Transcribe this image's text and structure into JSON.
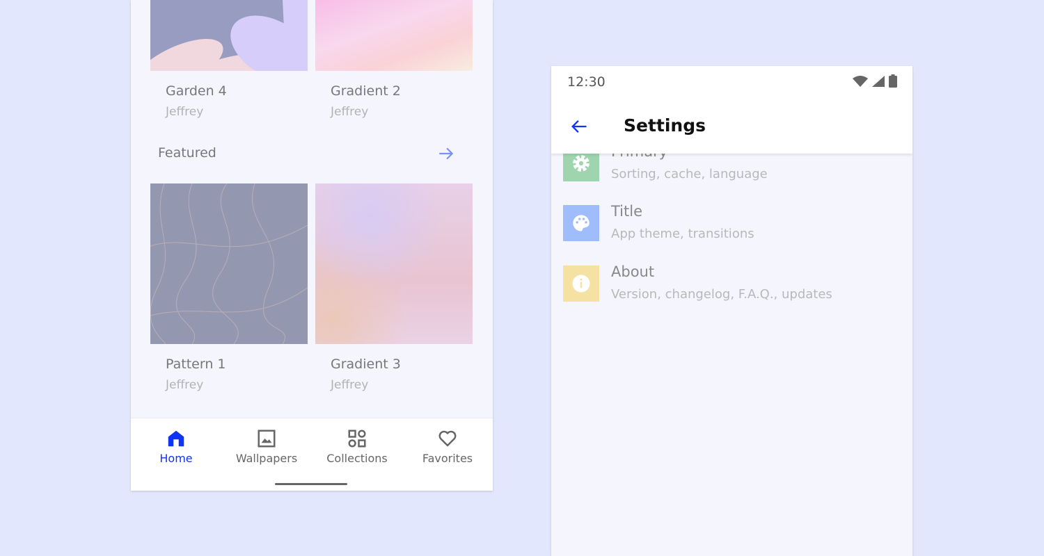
{
  "home": {
    "row1": [
      {
        "title": "Garden 4",
        "author": "Jeffrey"
      },
      {
        "title": "Gradient 2",
        "author": "Jeffrey"
      }
    ],
    "section": {
      "title": "Featured",
      "action_icon": "arrow-right-icon"
    },
    "row2": [
      {
        "title": "Pattern 1",
        "author": "Jeffrey"
      },
      {
        "title": "Gradient 3",
        "author": "Jeffrey"
      }
    ],
    "nav": [
      {
        "label": "Home",
        "icon": "home-icon",
        "active": true
      },
      {
        "label": "Wallpapers",
        "icon": "image-icon"
      },
      {
        "label": "Collections",
        "icon": "grid-icon"
      },
      {
        "label": "Favorites",
        "icon": "heart-icon"
      }
    ]
  },
  "settings": {
    "status": {
      "time": "12:30",
      "icons": [
        "wifi-icon",
        "signal-icon",
        "battery-icon"
      ]
    },
    "title": "Settings",
    "items": [
      {
        "title": "Primary",
        "subtitle": "Sorting, cache, language",
        "icon": "gear-icon",
        "color": "#9fd5ae"
      },
      {
        "title": "Title",
        "subtitle": "App theme, transitions",
        "icon": "palette-icon",
        "color": "#a0bdfb"
      },
      {
        "title": "About",
        "subtitle": "Version, changelog, F.A.Q., updates",
        "icon": "info-icon",
        "color": "#f5e2a3"
      }
    ]
  },
  "colors": {
    "accent": "#1034f5",
    "background": "#e3e7fd"
  }
}
